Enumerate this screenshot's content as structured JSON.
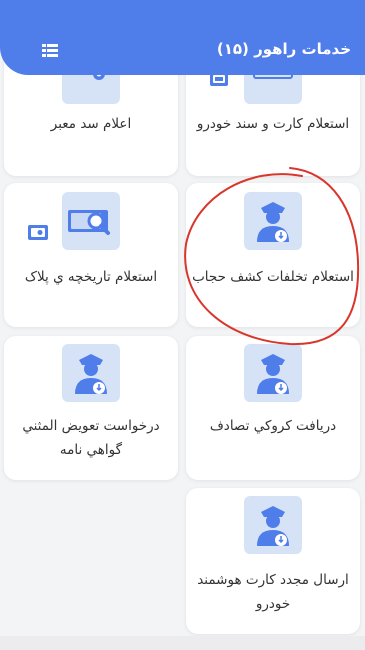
{
  "header": {
    "title": "خدمات راهور (۱۵)",
    "menu_icon": "list-view-icon",
    "background": "#4f7de9"
  },
  "cards": [
    {
      "label": "اعلام سد معبر",
      "icon": "document-officer-icon"
    },
    {
      "label": "استعلام کارت و سند خودرو",
      "icon": "vehicle-card-icon"
    },
    {
      "label": "استعلام تاریخچه ي پلاک",
      "icon": "plate-search-icon"
    },
    {
      "label": "استعلام تخلفات کشف حجاب",
      "icon": "police-officer-icon"
    },
    {
      "label": "درخواست تعویض المثني گواهي نامه",
      "icon": "police-officer-icon"
    },
    {
      "label": "دریافت کروکي تصادف",
      "icon": "police-officer-icon"
    },
    {
      "label": "ارسال مجدد کارت هوشمند خودرو",
      "icon": "police-officer-icon"
    }
  ],
  "annotation": {
    "shape": "hand-drawn-circle",
    "color": "#d9352b"
  }
}
